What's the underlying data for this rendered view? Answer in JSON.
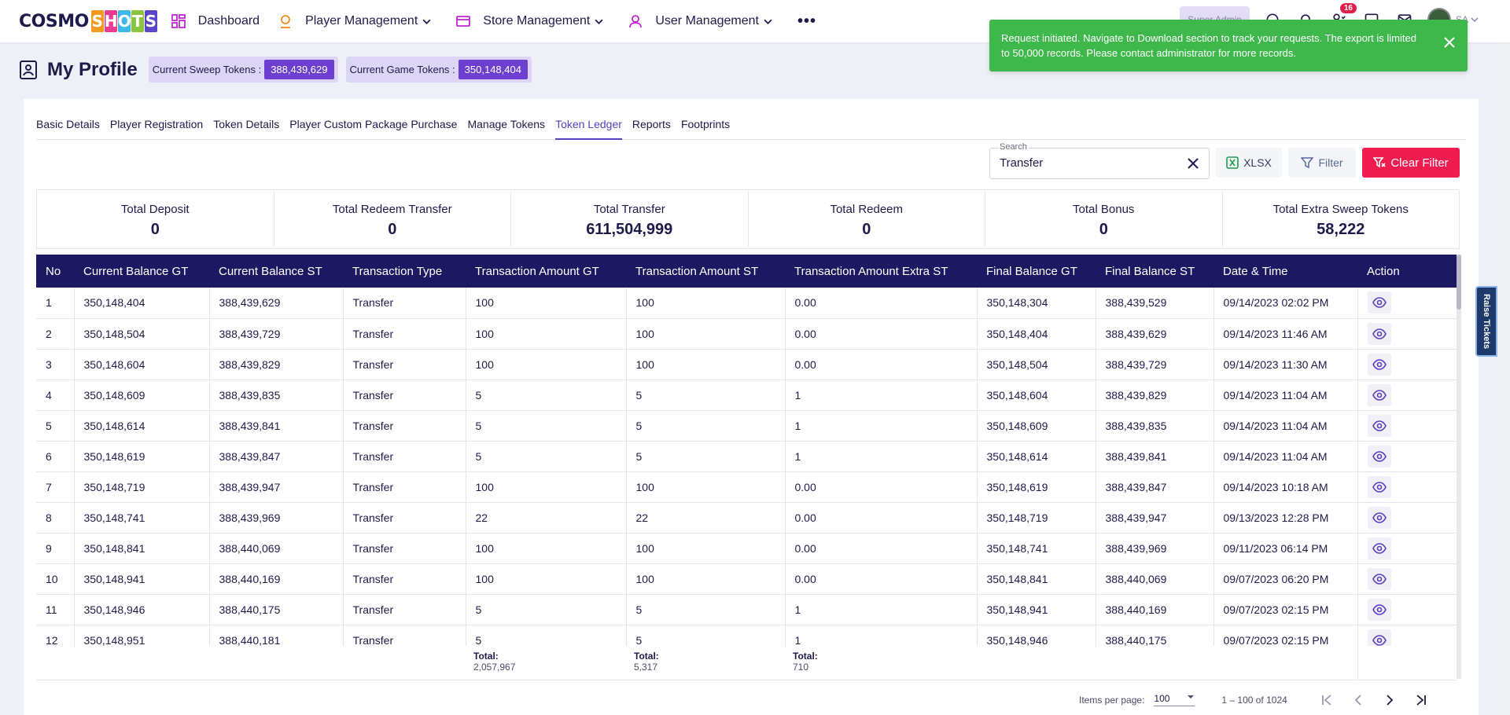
{
  "app": {
    "logo_left": "COSMO",
    "logo_letters": [
      "S",
      "H",
      "O",
      "T",
      "S"
    ],
    "logo_colors": [
      "#f29a1f",
      "#e93b8f",
      "#3db6e8",
      "#8bc53f",
      "#5a45c7"
    ]
  },
  "nav": {
    "items": [
      {
        "label": "Dashboard",
        "icon": "dashboard-icon",
        "has_dropdown": false
      },
      {
        "label": "Player Management",
        "icon": "player-icon",
        "has_dropdown": true
      },
      {
        "label": "Store Management",
        "icon": "store-icon",
        "has_dropdown": true
      },
      {
        "label": "User Management",
        "icon": "user-icon",
        "has_dropdown": true
      }
    ],
    "more": "•••"
  },
  "header_tools": {
    "role": "Super Admin",
    "notification_count": "16",
    "avatar_label": "SA"
  },
  "toast": {
    "message": "Request initiated. Navigate to Download section to track your requests. The export is limited to 50,000 records. Please contact administrator for more records.",
    "color": "#3eb84a"
  },
  "page": {
    "title": "My Profile",
    "sweep_label": "Current Sweep Tokens :",
    "sweep_value": "388,439,629",
    "game_label": "Current Game Tokens :",
    "game_value": "350,148,404"
  },
  "tabs": [
    {
      "label": "Basic Details",
      "active": false
    },
    {
      "label": "Player Registration",
      "active": false
    },
    {
      "label": "Token Details",
      "active": false
    },
    {
      "label": "Player Custom Package Purchase",
      "active": false
    },
    {
      "label": "Manage Tokens",
      "active": false
    },
    {
      "label": "Token Ledger",
      "active": true
    },
    {
      "label": "Reports",
      "active": false
    },
    {
      "label": "Footprints",
      "active": false
    }
  ],
  "toolbar": {
    "search_label": "Search",
    "search_value": "Transfer",
    "xlsx_label": "XLSX",
    "filter_label": "Filter",
    "clear_filter_label": "Clear Filter"
  },
  "stats": [
    {
      "label": "Total Deposit",
      "value": "0"
    },
    {
      "label": "Total Redeem Transfer",
      "value": "0"
    },
    {
      "label": "Total Transfer",
      "value": "611,504,999"
    },
    {
      "label": "Total Redeem",
      "value": "0"
    },
    {
      "label": "Total Bonus",
      "value": "0"
    },
    {
      "label": "Total Extra Sweep Tokens",
      "value": "58,222"
    }
  ],
  "table": {
    "columns": [
      "No",
      "Current Balance GT",
      "Current Balance ST",
      "Transaction Type",
      "Transaction Amount GT",
      "Transaction Amount ST",
      "Transaction Amount Extra ST",
      "Final Balance GT",
      "Final Balance ST",
      "Date & Time",
      "Action"
    ],
    "rows": [
      [
        "1",
        "350,148,404",
        "388,439,629",
        "Transfer",
        "100",
        "100",
        "0.00",
        "350,148,304",
        "388,439,529",
        "09/14/2023 02:02 PM"
      ],
      [
        "2",
        "350,148,504",
        "388,439,729",
        "Transfer",
        "100",
        "100",
        "0.00",
        "350,148,404",
        "388,439,629",
        "09/14/2023 11:46 AM"
      ],
      [
        "3",
        "350,148,604",
        "388,439,829",
        "Transfer",
        "100",
        "100",
        "0.00",
        "350,148,504",
        "388,439,729",
        "09/14/2023 11:30 AM"
      ],
      [
        "4",
        "350,148,609",
        "388,439,835",
        "Transfer",
        "5",
        "5",
        "1",
        "350,148,604",
        "388,439,829",
        "09/14/2023 11:04 AM"
      ],
      [
        "5",
        "350,148,614",
        "388,439,841",
        "Transfer",
        "5",
        "5",
        "1",
        "350,148,609",
        "388,439,835",
        "09/14/2023 11:04 AM"
      ],
      [
        "6",
        "350,148,619",
        "388,439,847",
        "Transfer",
        "5",
        "5",
        "1",
        "350,148,614",
        "388,439,841",
        "09/14/2023 11:04 AM"
      ],
      [
        "7",
        "350,148,719",
        "388,439,947",
        "Transfer",
        "100",
        "100",
        "0.00",
        "350,148,619",
        "388,439,847",
        "09/14/2023 10:18 AM"
      ],
      [
        "8",
        "350,148,741",
        "388,439,969",
        "Transfer",
        "22",
        "22",
        "0.00",
        "350,148,719",
        "388,439,947",
        "09/13/2023 12:28 PM"
      ],
      [
        "9",
        "350,148,841",
        "388,440,069",
        "Transfer",
        "100",
        "100",
        "0.00",
        "350,148,741",
        "388,439,969",
        "09/11/2023 06:14 PM"
      ],
      [
        "10",
        "350,148,941",
        "388,440,169",
        "Transfer",
        "100",
        "100",
        "0.00",
        "350,148,841",
        "388,440,069",
        "09/07/2023 06:20 PM"
      ],
      [
        "11",
        "350,148,946",
        "388,440,175",
        "Transfer",
        "5",
        "5",
        "1",
        "350,148,941",
        "388,440,169",
        "09/07/2023 02:15 PM"
      ],
      [
        "12",
        "350,148,951",
        "388,440,181",
        "Transfer",
        "5",
        "5",
        "1",
        "350,148,946",
        "388,440,175",
        "09/07/2023 02:15 PM"
      ]
    ]
  },
  "totals": [
    {
      "label": "Total:",
      "value": "2,057,967"
    },
    {
      "label": "Total:",
      "value": "5,317"
    },
    {
      "label": "Total:",
      "value": "710"
    }
  ],
  "paginator": {
    "items_label": "Items per page:",
    "page_size": "100",
    "range": "1 – 100 of 1024"
  },
  "side_tab": {
    "label": "Raise Tickets"
  }
}
